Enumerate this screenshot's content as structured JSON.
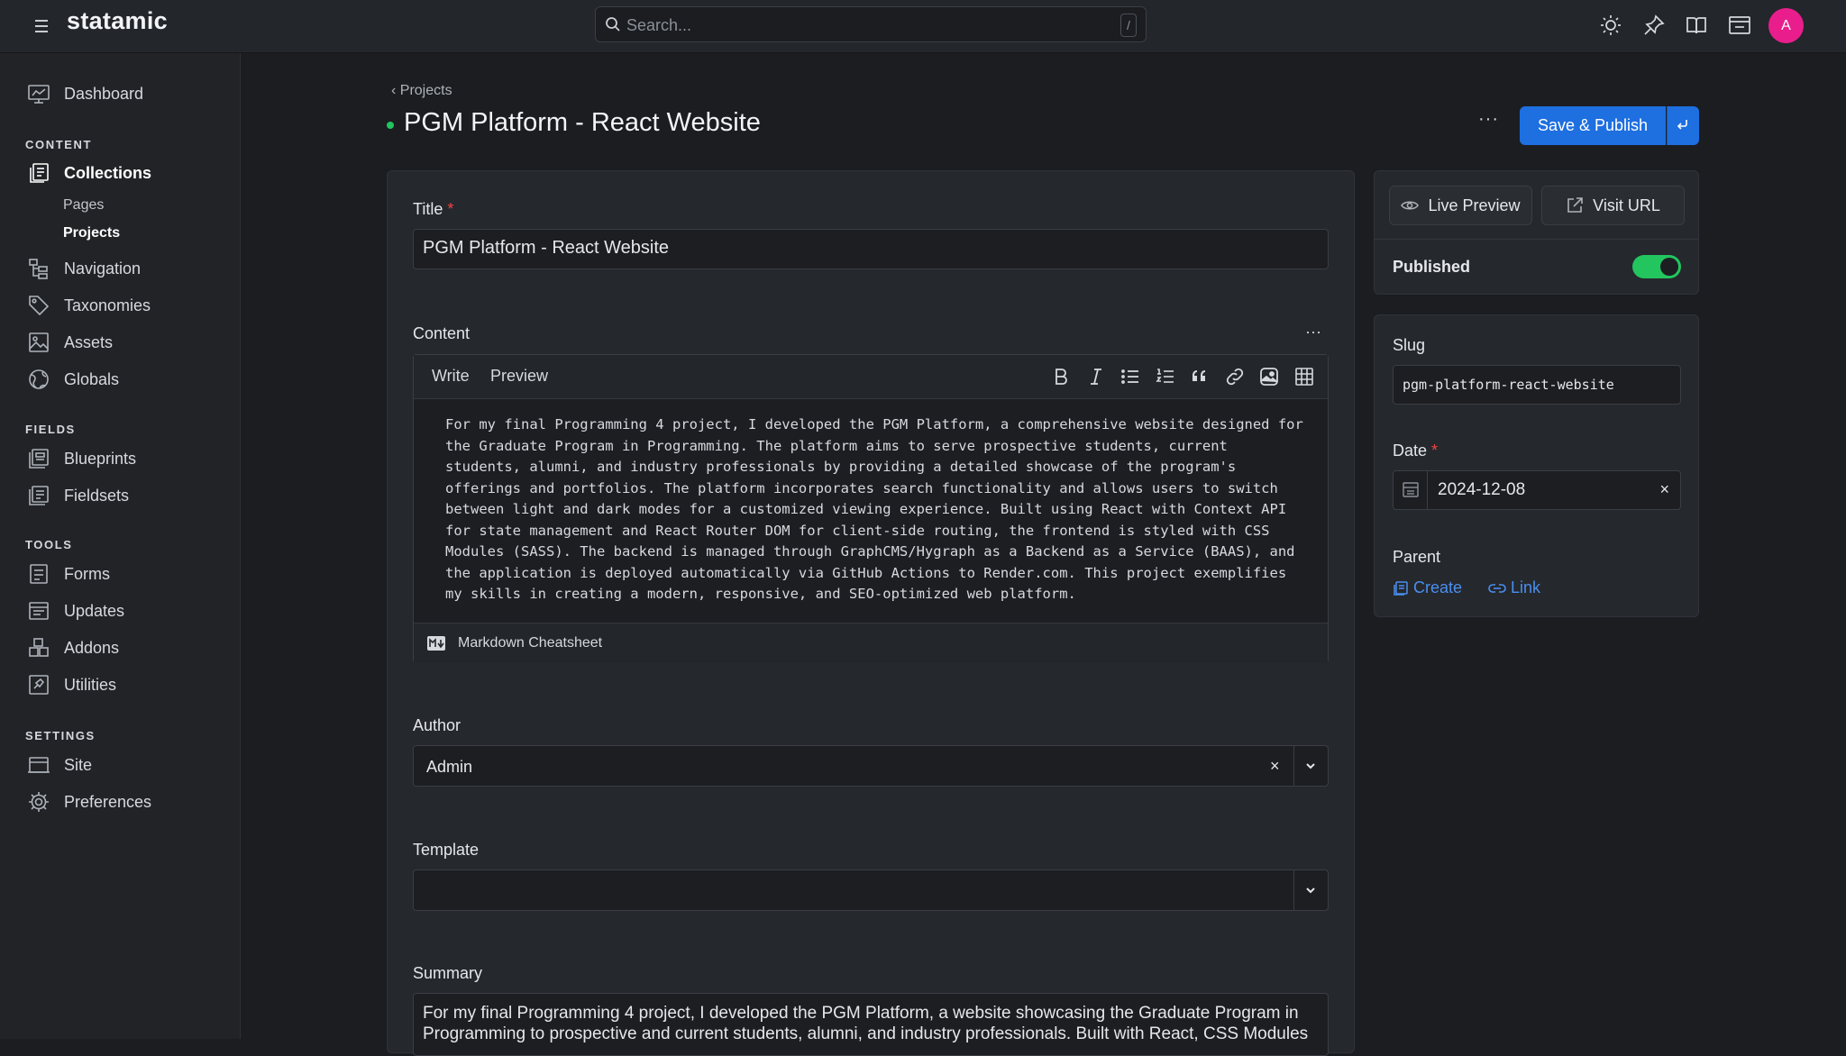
{
  "app": {
    "logo": "statamic"
  },
  "search": {
    "placeholder": "Search...",
    "shortcut": "/"
  },
  "user": {
    "avatar_initial": "A"
  },
  "sidebar": {
    "dashboard": "Dashboard",
    "sections": {
      "content": "CONTENT",
      "fields": "FIELDS",
      "tools": "TOOLS",
      "settings": "SETTINGS"
    },
    "collections": "Collections",
    "pages": "Pages",
    "projects": "Projects",
    "navigation": "Navigation",
    "taxonomies": "Taxonomies",
    "assets": "Assets",
    "globals": "Globals",
    "blueprints": "Blueprints",
    "fieldsets": "Fieldsets",
    "forms": "Forms",
    "updates": "Updates",
    "addons": "Addons",
    "utilities": "Utilities",
    "site": "Site",
    "preferences": "Preferences"
  },
  "header": {
    "breadcrumb": "Projects",
    "title": "PGM Platform - React Website",
    "save_label": "Save & Publish",
    "status_color": "#22c55e"
  },
  "form": {
    "title_label": "Title",
    "title_value": "PGM Platform - React Website",
    "content_label": "Content",
    "write_tab": "Write",
    "preview_tab": "Preview",
    "content_text": "For my final Programming 4 project, I developed the PGM Platform, a comprehensive website designed for the Graduate Program in Programming. The platform aims to serve prospective students, current students, alumni, and industry professionals by providing a detailed showcase of the program's offerings and portfolios. The platform incorporates search functionality and allows users to switch between light and dark modes for a customized viewing experience. Built using React with Context API for state management and React Router DOM for client-side routing, the frontend is styled with CSS Modules (SASS). The backend is managed through GraphCMS/Hygraph as a Backend as a Service (BAAS), and the application is deployed automatically via GitHub Actions to Render.com. This project exemplifies my skills in creating a modern, responsive, and SEO-optimized web platform.",
    "markdown_cheatsheet": "Markdown Cheatsheet",
    "author_label": "Author",
    "author_value": "Admin",
    "template_label": "Template",
    "template_value": "",
    "summary_label": "Summary",
    "summary_value": "For my final Programming 4 project, I developed the PGM Platform, a website showcasing the Graduate Program in Programming to prospective and current students, alumni, and industry professionals. Built with React, CSS Modules"
  },
  "sidepanel": {
    "live_preview": "Live Preview",
    "visit_url": "Visit URL",
    "published_label": "Published",
    "published": true,
    "slug_label": "Slug",
    "slug_value": "pgm-platform-react-website",
    "date_label": "Date",
    "date_value": "2024-12-08",
    "parent_label": "Parent",
    "create_label": "Create",
    "link_label": "Link"
  },
  "colors": {
    "accent": "#1e6fe0",
    "toggle_on": "#22c55e",
    "avatar": "#e91e8c",
    "link": "#4a8ff0"
  }
}
